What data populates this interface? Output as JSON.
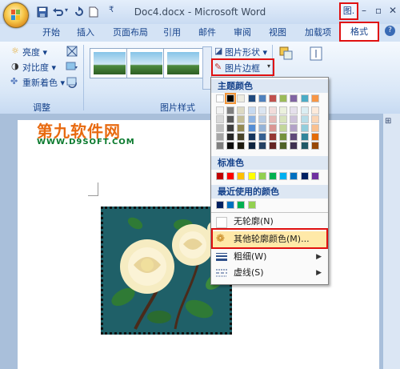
{
  "titlebar": {
    "document_title": "Doc4.docx - Microsoft Word",
    "tools_label": "图.",
    "minimize": "–",
    "restore": "▫",
    "close": "✕"
  },
  "tabs": [
    "开始",
    "插入",
    "页面布局",
    "引用",
    "邮件",
    "审阅",
    "视图",
    "加载项"
  ],
  "active_tab": "格式",
  "help_icon": "?",
  "ribbon": {
    "adjust": {
      "brightness": "亮度 ▾",
      "contrast": "对比度 ▾",
      "recolor": "重新着色 ▾",
      "group_label": "调整"
    },
    "picture_styles": {
      "shape_label": "图片形状 ▾",
      "border_label": "图片边框",
      "group_label": "图片样式"
    }
  },
  "watermark": {
    "line1": "第九软件网",
    "line2": "WWW.D9SOFT.COM"
  },
  "dropdown": {
    "theme_header": "主题颜色",
    "standard_header": "标准色",
    "recent_header": "最近使用的颜色",
    "no_outline": "无轮廓(N)",
    "more_colors": "其他轮廓颜色(M)...",
    "weight": "粗细(W)",
    "dashes": "虚线(S)",
    "theme_top_row": [
      "#ffffff",
      "#000000",
      "#eeece1",
      "#1f497d",
      "#4f81bd",
      "#c0504d",
      "#9bbb59",
      "#8064a2",
      "#4bacc6",
      "#f79646"
    ],
    "theme_columns": [
      [
        "#f2f2f2",
        "#d8d8d8",
        "#bfbfbf",
        "#a5a5a5",
        "#7f7f7f"
      ],
      [
        "#7f7f7f",
        "#595959",
        "#3f3f3f",
        "#262626",
        "#0c0c0c"
      ],
      [
        "#ddd9c3",
        "#c4bd97",
        "#938953",
        "#494429",
        "#1d1b10"
      ],
      [
        "#c6d9f0",
        "#8db3e2",
        "#548dd4",
        "#17365d",
        "#0f243e"
      ],
      [
        "#dbe5f1",
        "#b8cce4",
        "#95b3d7",
        "#366092",
        "#244061"
      ],
      [
        "#f2dcdb",
        "#e5b9b7",
        "#d99694",
        "#953734",
        "#632423"
      ],
      [
        "#ebf1dd",
        "#d7e3bc",
        "#c3d69b",
        "#76923c",
        "#4f6128"
      ],
      [
        "#e5e0ec",
        "#ccc1d9",
        "#b2a2c7",
        "#5f497a",
        "#3f3151"
      ],
      [
        "#dbeef3",
        "#b7dde8",
        "#92cddc",
        "#31859b",
        "#205867"
      ],
      [
        "#fdeada",
        "#fbd5b5",
        "#fac08f",
        "#e36c09",
        "#974806"
      ]
    ],
    "standard_colors": [
      "#c00000",
      "#ff0000",
      "#ffc000",
      "#ffff00",
      "#92d050",
      "#00b050",
      "#00b0f0",
      "#0070c0",
      "#002060",
      "#7030a0"
    ],
    "recent_colors": [
      "#002060",
      "#0070c0",
      "#00b050",
      "#92d050"
    ]
  }
}
